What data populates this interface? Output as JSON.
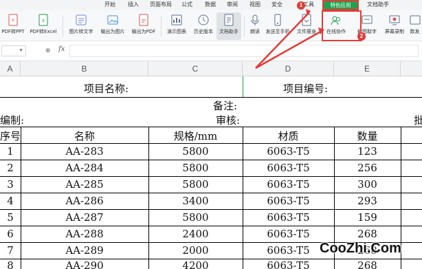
{
  "menu": {
    "tabs": [
      "开始",
      "插入",
      "页面布局",
      "公式",
      "数据",
      "审阅",
      "视图",
      "安全",
      "工具",
      "特色应用",
      "文档助手"
    ]
  },
  "ribbon": {
    "tools": [
      {
        "label": "PDF转PPT",
        "icon": "pdf-to-ppt-icon"
      },
      {
        "label": "PDF转Excel",
        "icon": "pdf-to-excel-icon"
      },
      {
        "label": "图片转文字",
        "icon": "image-to-text-icon"
      },
      {
        "label": "输出为图片",
        "icon": "export-image-icon"
      },
      {
        "label": "输出为PDF",
        "icon": "export-pdf-icon"
      },
      {
        "label": "演示图表",
        "icon": "chart-icon"
      },
      {
        "label": "历史版本",
        "icon": "history-icon"
      },
      {
        "label": "文档助手",
        "icon": "document-assistant-icon"
      },
      {
        "label": "朗读",
        "icon": "read-aloud-icon"
      },
      {
        "label": "发送至手机",
        "icon": "send-to-phone-icon"
      },
      {
        "label": "文件瘦身",
        "icon": "file-slim-icon"
      },
      {
        "label": "在线协作",
        "icon": "collaborate-icon"
      },
      {
        "label": "截图取字",
        "icon": "screenshot-text-icon"
      },
      {
        "label": "屏幕录制",
        "icon": "screen-record-icon"
      },
      {
        "label": "数发",
        "icon": "share-icon"
      }
    ]
  },
  "formula": {
    "fx": "fx",
    "zoom": "⊕"
  },
  "columns": [
    "A",
    "B",
    "C",
    "D",
    "E"
  ],
  "sheet": {
    "project_name": "项目名称:",
    "project_no": "项目编号:",
    "remark": "备注:",
    "compiler": "编制:",
    "reviewer": "审核:",
    "approver": "批",
    "headers": [
      "序号",
      "名称",
      "规格/mm",
      "材质",
      "数量"
    ],
    "rows": [
      [
        "1",
        "AA-283",
        "5800",
        "6063-T5",
        "123"
      ],
      [
        "2",
        "AA-284",
        "5800",
        "6063-T5",
        "256"
      ],
      [
        "3",
        "AA-285",
        "5800",
        "6063-T5",
        "300"
      ],
      [
        "4",
        "AA-286",
        "3400",
        "6063-T5",
        "293"
      ],
      [
        "5",
        "AA-287",
        "5800",
        "6063-T5",
        "159"
      ],
      [
        "6",
        "AA-288",
        "2400",
        "6063-T5",
        "268"
      ],
      [
        "7",
        "AA-289",
        "2000",
        "6063-T5",
        "268"
      ],
      [
        "8",
        "AA-290",
        "4200",
        "6063-T5",
        "268"
      ]
    ]
  },
  "annotation": {
    "badge1": "1",
    "badge2": "2",
    "color": "#e53935"
  },
  "watermark": "CooZhi.Com"
}
